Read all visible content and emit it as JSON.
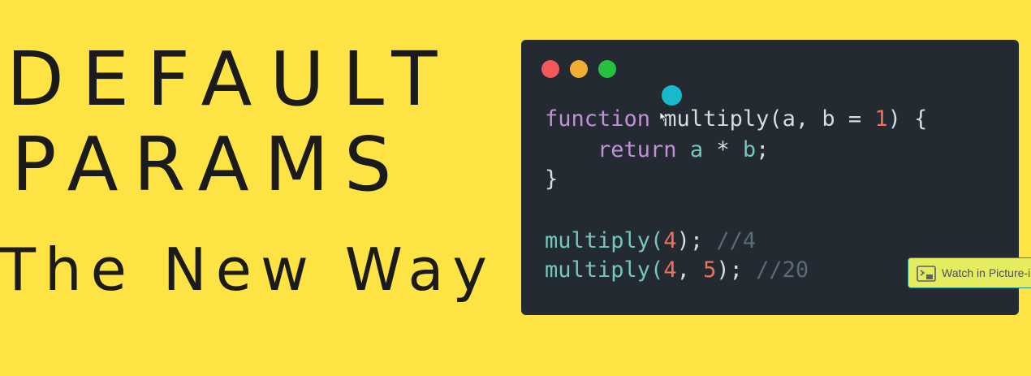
{
  "headline": {
    "line1": "DEFAULT",
    "line2": "PARAMS",
    "subtitle": "The New Way"
  },
  "code_window": {
    "lines": [
      {
        "tokens": [
          {
            "text": "function",
            "kind": "kw"
          },
          {
            "text": " multiply(a, b = ",
            "kind": "plain"
          },
          {
            "text": "1",
            "kind": "num"
          },
          {
            "text": ") {",
            "kind": "plain"
          }
        ]
      },
      {
        "tokens": [
          {
            "text": "    return ",
            "kind": "kw"
          },
          {
            "text": "a",
            "kind": "var"
          },
          {
            "text": " * ",
            "kind": "plain"
          },
          {
            "text": "b",
            "kind": "var"
          },
          {
            "text": ";",
            "kind": "plain"
          }
        ]
      },
      {
        "tokens": [
          {
            "text": "}",
            "kind": "plain"
          }
        ]
      },
      {
        "tokens": [
          {
            "text": "multiply(",
            "kind": "call"
          },
          {
            "text": "4",
            "kind": "num"
          },
          {
            "text": "); ",
            "kind": "plain"
          },
          {
            "text": "//4",
            "kind": "cmt"
          }
        ]
      },
      {
        "tokens": [
          {
            "text": "multiply(",
            "kind": "call"
          },
          {
            "text": "4",
            "kind": "num"
          },
          {
            "text": ", ",
            "kind": "plain"
          },
          {
            "text": "5",
            "kind": "num"
          },
          {
            "text": "); ",
            "kind": "plain"
          },
          {
            "text": "//20",
            "kind": "cmt"
          }
        ]
      }
    ],
    "window_controls": [
      "close-dot",
      "minimize-dot",
      "maximize-dot"
    ]
  },
  "pip_button": {
    "label": "Watch in Picture-in-Picture",
    "icon": "picture-in-picture-icon"
  },
  "colors": {
    "background": "#FDE343",
    "editor": "#232A31",
    "keyword": "#C191D6",
    "number": "#F0705A",
    "call": "#74C7BE",
    "comment": "#5B6B75"
  }
}
